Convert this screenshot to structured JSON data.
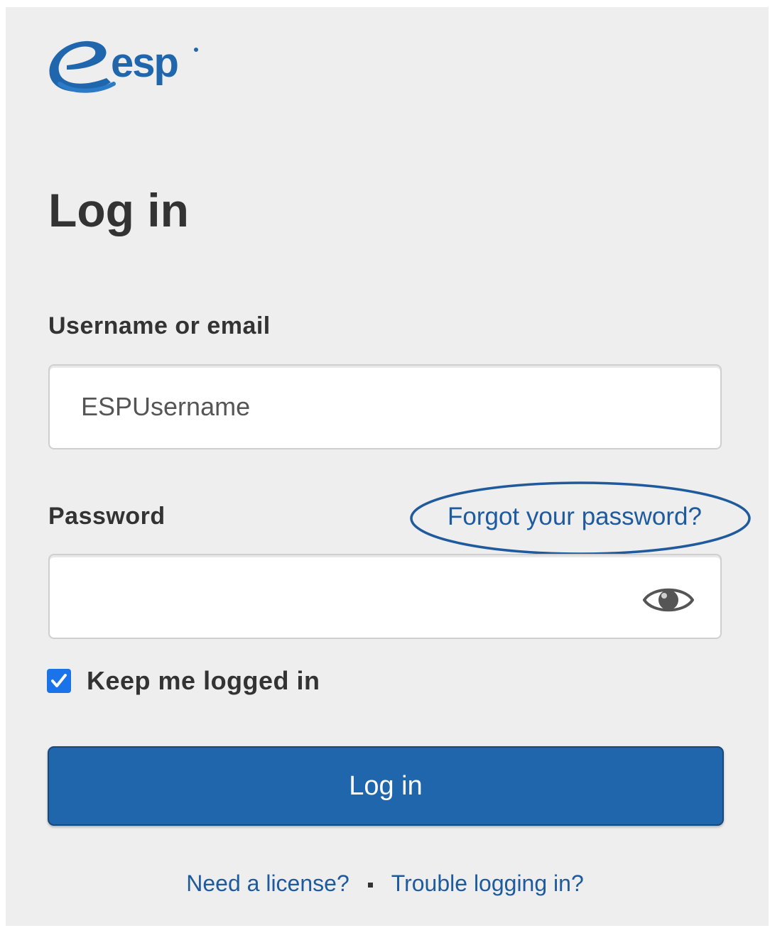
{
  "brand": {
    "logo_text": "esp",
    "brand_color": "#1f66ad"
  },
  "page": {
    "title": "Log in"
  },
  "form": {
    "username_label": "Username or email",
    "username_value": "ESPUsername",
    "password_label": "Password",
    "password_value": "",
    "forgot_password": "Forgot your password?",
    "keep_logged_in_label": "Keep me logged in",
    "keep_logged_in_checked": true,
    "submit_label": "Log in"
  },
  "footer": {
    "need_license": "Need a license?",
    "trouble": "Trouble logging in?"
  },
  "icons": {
    "password_toggle": "eye-icon",
    "checkbox": "checkmark-icon"
  },
  "colors": {
    "background": "#eeeeee",
    "link": "#1e5a9e",
    "button": "#1f66ad",
    "checkbox": "#1a73e8"
  }
}
